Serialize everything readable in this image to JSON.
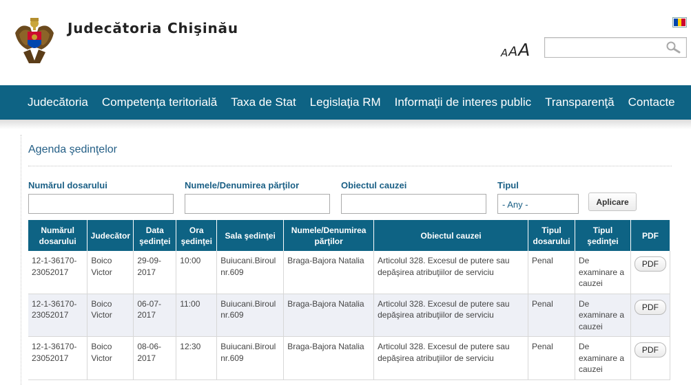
{
  "header": {
    "title": "Judecătoria Chişinău",
    "font_sizes": [
      "A",
      "A",
      "A"
    ],
    "search": {
      "placeholder": "",
      "value": ""
    },
    "flag_colors": [
      "#0046ae",
      "#ffd200",
      "#cc092f"
    ]
  },
  "nav": {
    "items": [
      "Judecătoria",
      "Competenţa teritorială",
      "Taxa de Stat",
      "Legislaţia RM",
      "Informaţii de interes public",
      "Transparenţă",
      "Contacte"
    ]
  },
  "main": {
    "title": "Agenda şedinţelor",
    "filters": {
      "case_number_label": "Numărul dosarului",
      "parties_label": "Numele/Denumirea părţilor",
      "object_label": "Obiectul cauzei",
      "type_label": "Tipul",
      "type_value": "- Any -",
      "apply_label": "Aplicare"
    },
    "table": {
      "headers": [
        "Numărul dosarului",
        "Judecător",
        "Data şedinţei",
        "Ora şedinţei",
        "Sala şedinţei",
        "Numele/Denumirea părţilor",
        "Obiectul cauzei",
        "Tipul dosarului",
        "Tipul şedinţei",
        "PDF"
      ],
      "rows": [
        [
          "12-1-36170-23052017",
          "Boico Victor",
          "29-09-2017",
          "10:00",
          "Buiucani.Biroul nr.609",
          "Braga-Bajora Natalia",
          "Articolul 328. Excesul de putere sau depăşirea atribuţiilor de serviciu",
          "Penal",
          "De examinare a cauzei",
          "PDF"
        ],
        [
          "12-1-36170-23052017",
          "Boico Victor",
          "06-07-2017",
          "11:00",
          "Buiucani.Biroul nr.609",
          "Braga-Bajora Natalia",
          "Articolul 328. Excesul de putere sau depăşirea atribuţiilor de serviciu",
          "Penal",
          "De examinare a cauzei",
          "PDF"
        ],
        [
          "12-1-36170-23052017",
          "Boico Victor",
          "08-06-2017",
          "12:30",
          "Buiucani.Biroul nr.609",
          "Braga-Bajora Natalia",
          "Articolul 328. Excesul de putere sau depăşirea atribuţiilor de serviciu",
          "Penal",
          "De examinare a cauzei",
          "PDF"
        ]
      ]
    }
  }
}
